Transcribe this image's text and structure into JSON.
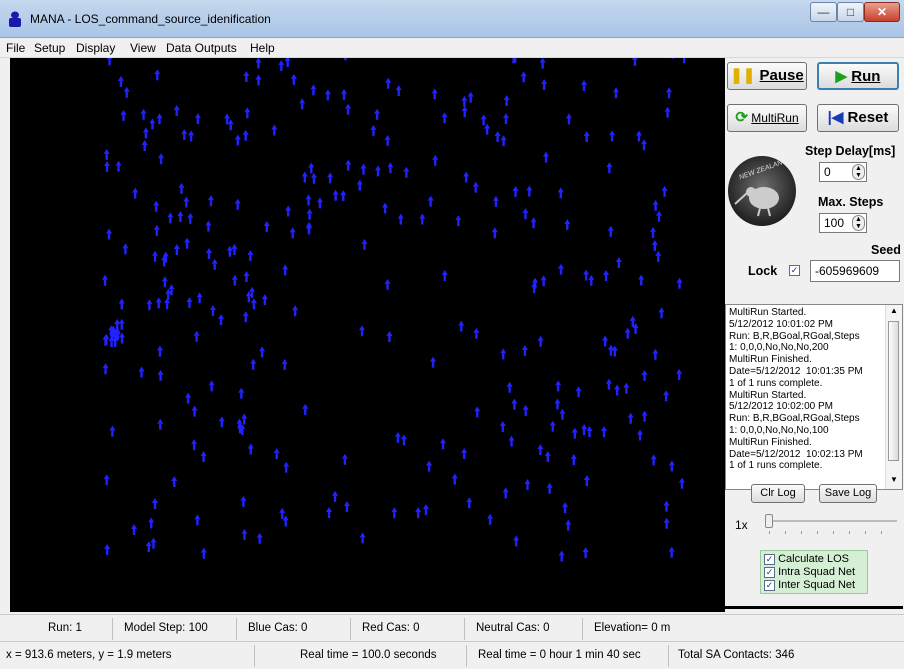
{
  "window": {
    "title": "MANA - LOS_command_source_idenification"
  },
  "menu": [
    "File",
    "Setup",
    "Display",
    "View",
    "Data Outputs",
    "Help"
  ],
  "controls": {
    "pause": "Pause",
    "run": "Run",
    "multirun": "MultiRun",
    "reset": "Reset",
    "step_delay_label": "Step Delay[ms]",
    "step_delay_value": "0",
    "max_steps_label": "Max. Steps",
    "max_steps_value": "100",
    "seed_label": "Seed",
    "lock_label": "Lock",
    "seed_value": "-605969609",
    "logo_text": "NEW ZEALAND"
  },
  "log": {
    "lines": [
      "MultiRun Started.",
      "5/12/2012 10:01:02 PM",
      "Run: B,R,BGoal,RGoal,Steps",
      "1: 0,0,0,No,No,No,200",
      "MultiRun Finished.",
      "Date=5/12/2012  10:01:35 PM",
      "1 of 1 runs complete.",
      "MultiRun Started.",
      "5/12/2012 10:02:00 PM",
      "Run: B,R,BGoal,RGoal,Steps",
      "1: 0,0,0,No,No,No,100",
      "MultiRun Finished.",
      "Date=5/12/2012  10:02:13 PM",
      "1 of 1 runs complete."
    ],
    "clear": "Clr Log",
    "save": "Save Log"
  },
  "speed": {
    "label": "1x"
  },
  "options": [
    "Calculate LOS",
    "Intra Squad Net",
    "Inter Squad Net"
  ],
  "status1": {
    "run": "Run: 1",
    "model_step": "Model Step: 100",
    "blue_cas": "Blue Cas: 0",
    "red_cas": "Red Cas: 0",
    "neutral_cas": "Neutral Cas: 0",
    "elevation": "Elevation= 0 m"
  },
  "status2": {
    "coords": "x = 913.6 meters,  y = 1.9 meters",
    "real_time_s": "Real time = 100.0 seconds",
    "real_time_hms": "Real time = 0 hour 1 min 40 sec",
    "sa_contacts": "Total SA Contacts: 346"
  },
  "colors": {
    "agent": "#2222ff",
    "canvas": "#000000",
    "accent_run": "#1aa01a"
  }
}
